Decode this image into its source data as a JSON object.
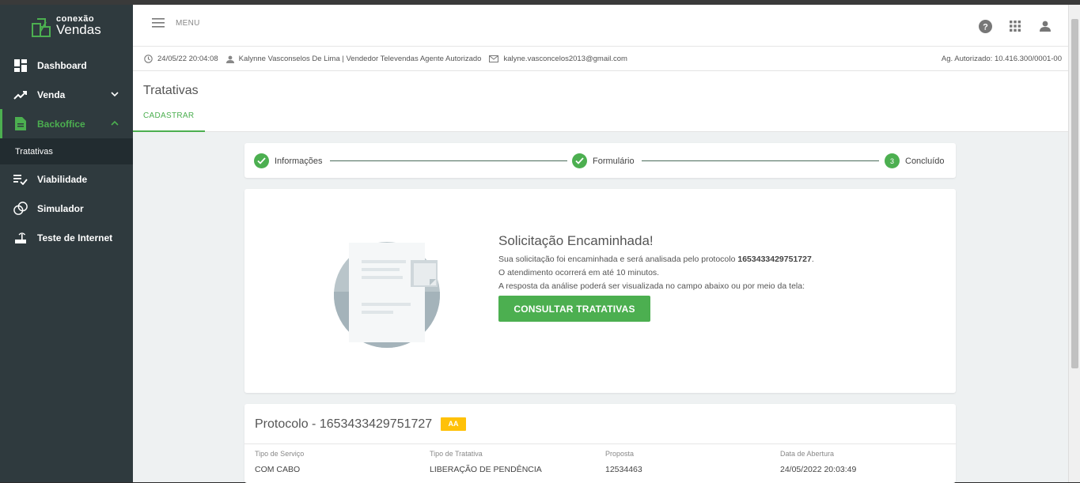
{
  "brand": {
    "line1": "conexão",
    "line2": "Vendas",
    "accent": "#4caf50"
  },
  "sidebar": {
    "items": [
      {
        "label": "Dashboard",
        "icon": "dashboard-icon"
      },
      {
        "label": "Venda",
        "icon": "trending-up-icon"
      },
      {
        "label": "Backoffice",
        "icon": "document-icon"
      },
      {
        "label": "Viabilidade",
        "icon": "checklist-icon"
      },
      {
        "label": "Simulador",
        "icon": "circles-icon"
      },
      {
        "label": "Teste de Internet",
        "icon": "router-icon"
      }
    ],
    "subitem": "Tratativas"
  },
  "header": {
    "menu_label": "MENU"
  },
  "infobar": {
    "datetime": "24/05/22 20:04:08",
    "user": "Kalynne Vasconselos De Lima | Vendedor Televendas Agente Autorizado",
    "email": "kalyne.vasconcelos2013@gmail.com",
    "agent": "Ag. Autorizado: 10.416.300/0001-00"
  },
  "page": {
    "title": "Tratativas",
    "tab": "CADASTRAR"
  },
  "stepper": {
    "steps": [
      {
        "label": "Informações",
        "state": "done"
      },
      {
        "label": "Formulário",
        "state": "done"
      },
      {
        "label": "Concluído",
        "state": "current",
        "number": "3"
      }
    ]
  },
  "success": {
    "title": "Solicitação Encaminhada!",
    "line1_pre": "Sua solicitação foi encaminhada e será analisada pelo protocolo ",
    "protocol": "1653433429751727",
    "line1_post": ".",
    "line2": "O atendimento ocorrerá em até 10 minutos.",
    "line3": "A resposta da análise poderá ser visualizada no campo abaixo ou por meio da tela:",
    "button": "CONSULTAR TRATATIVAS"
  },
  "protocol_card": {
    "title": "Protocolo - 1653433429751727",
    "badge": "AA",
    "badge_color": "#ffc107",
    "fields": [
      {
        "key": "Tipo de Serviço",
        "value": "COM CABO"
      },
      {
        "key": "Tipo de Tratativa",
        "value": "LIBERAÇÃO DE PENDÊNCIA"
      },
      {
        "key": "Proposta",
        "value": "12534463"
      },
      {
        "key": "Data de Abertura",
        "value": "24/05/2022 20:03:49"
      }
    ]
  }
}
